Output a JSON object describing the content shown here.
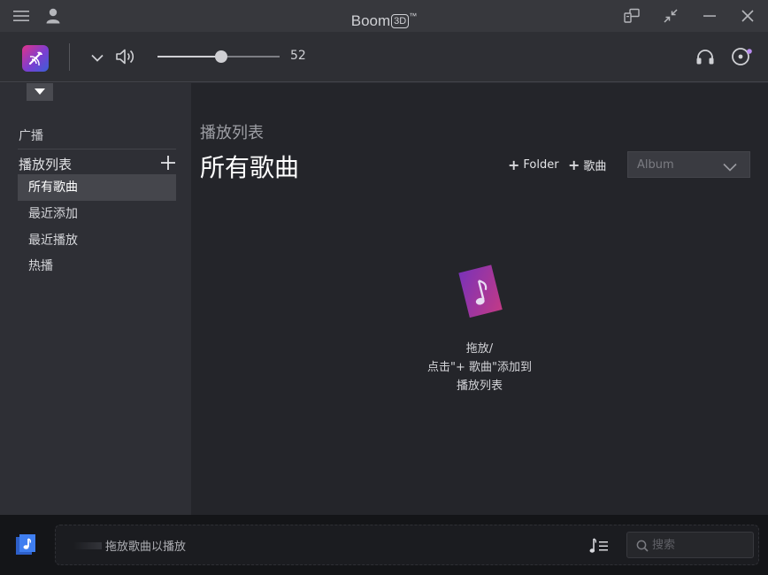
{
  "titlebar": {
    "title": "Boom",
    "title_badge": "3D",
    "title_tm": "™"
  },
  "controls": {
    "volume": 52,
    "volume_max": 100
  },
  "sidebar": {
    "section_radio": "广播",
    "section_playlists": "播放列表",
    "add_symbol": "+",
    "items": [
      {
        "label": "所有歌曲",
        "active": true
      },
      {
        "label": "最近添加",
        "active": false
      },
      {
        "label": "最近播放",
        "active": false
      },
      {
        "label": "热播",
        "active": false
      }
    ]
  },
  "main": {
    "subtitle": "播放列表",
    "title": "所有歌曲",
    "add_folder_label": "Folder",
    "add_song_label": "歌曲",
    "sort_value": "Album",
    "empty_line1": "拖放/",
    "empty_line2": "点击\"+ 歌曲\"添加到",
    "empty_line3": "播放列表"
  },
  "bottombar": {
    "drop_hint": "拖放歌曲以播放",
    "search_placeholder": "搜索"
  },
  "colors": {
    "accent_gradient_start": "#e0338a",
    "accent_gradient_end": "#3b5fd8",
    "active_item_bg": "#45464c"
  }
}
